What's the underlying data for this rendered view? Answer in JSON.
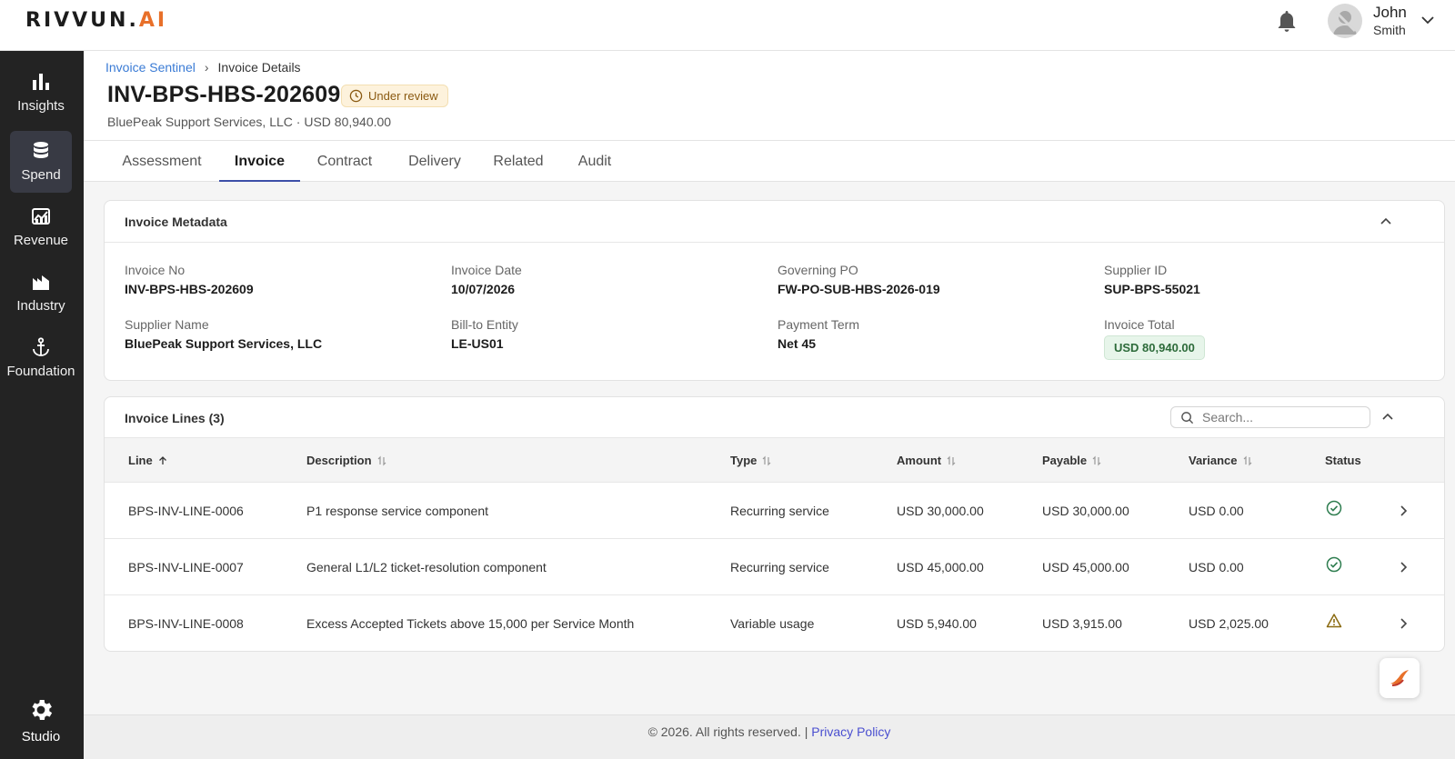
{
  "app": {
    "logo_main": "RIVVUN.",
    "logo_accent": "AI"
  },
  "user": {
    "first_name": "John",
    "last_name": "Smith"
  },
  "sidebar": {
    "items": [
      {
        "label": "Insights",
        "icon": "bar-chart-icon"
      },
      {
        "label": "Spend",
        "icon": "database-icon"
      },
      {
        "label": "Revenue",
        "icon": "revenue-chart-icon"
      },
      {
        "label": "Industry",
        "icon": "industry-chart-icon"
      },
      {
        "label": "Foundation",
        "icon": "anchor-icon"
      }
    ],
    "active_item": "Spend",
    "studio_label": "Studio"
  },
  "breadcrumb": {
    "parent": "Invoice Sentinel",
    "current": "Invoice Details"
  },
  "header": {
    "title": "INV-BPS-HBS-202609",
    "status": "Under review",
    "subtitle": "BluePeak Support Services, LLC · USD 80,940.00"
  },
  "tabs": [
    "Assessment",
    "Invoice",
    "Contract",
    "Delivery",
    "Related",
    "Audit"
  ],
  "active_tab": "Invoice",
  "metadata": {
    "title": "Invoice Metadata",
    "fields": [
      {
        "label": "Invoice No",
        "value": "INV-BPS-HBS-202609"
      },
      {
        "label": "Invoice Date",
        "value": "10/07/2026"
      },
      {
        "label": "Governing PO",
        "value": "FW-PO-SUB-HBS-2026-019"
      },
      {
        "label": "Supplier ID",
        "value": "SUP-BPS-55021"
      },
      {
        "label": "Supplier Name",
        "value": "BluePeak Support Services, LLC"
      },
      {
        "label": "Bill-to Entity",
        "value": "LE-US01"
      },
      {
        "label": "Payment Term",
        "value": "Net 45"
      },
      {
        "label": "Invoice Total",
        "value": "USD 80,940.00"
      }
    ]
  },
  "lines": {
    "title": "Invoice Lines (3)",
    "search_placeholder": "Search...",
    "columns": [
      "Line",
      "Description",
      "Type",
      "Amount",
      "Payable",
      "Variance",
      "Status"
    ],
    "rows": [
      {
        "line": "BPS-INV-LINE-0006",
        "description": "P1 response service component",
        "type": "Recurring service",
        "amount": "USD 30,000.00",
        "payable": "USD 30,000.00",
        "variance": "USD 0.00",
        "status": "ok"
      },
      {
        "line": "BPS-INV-LINE-0007",
        "description": "General L1/L2 ticket-resolution component",
        "type": "Recurring service",
        "amount": "USD 45,000.00",
        "payable": "USD 45,000.00",
        "variance": "USD 0.00",
        "status": "ok"
      },
      {
        "line": "BPS-INV-LINE-0008",
        "description": "Excess Accepted Tickets above 15,000 per Service Month",
        "type": "Variable usage",
        "amount": "USD 5,940.00",
        "payable": "USD 3,915.00",
        "variance": "USD 2,025.00",
        "status": "warning"
      }
    ]
  },
  "footer": {
    "copyright": "© 2026. All rights reserved. |",
    "link": "Privacy Policy"
  },
  "colors": {
    "sidebar_bg": "#232323",
    "accent": "#3d4fa8",
    "status_ok": "#2e7d4f",
    "status_warning": "#8a6a10",
    "logo_accent": "#e8702a"
  }
}
